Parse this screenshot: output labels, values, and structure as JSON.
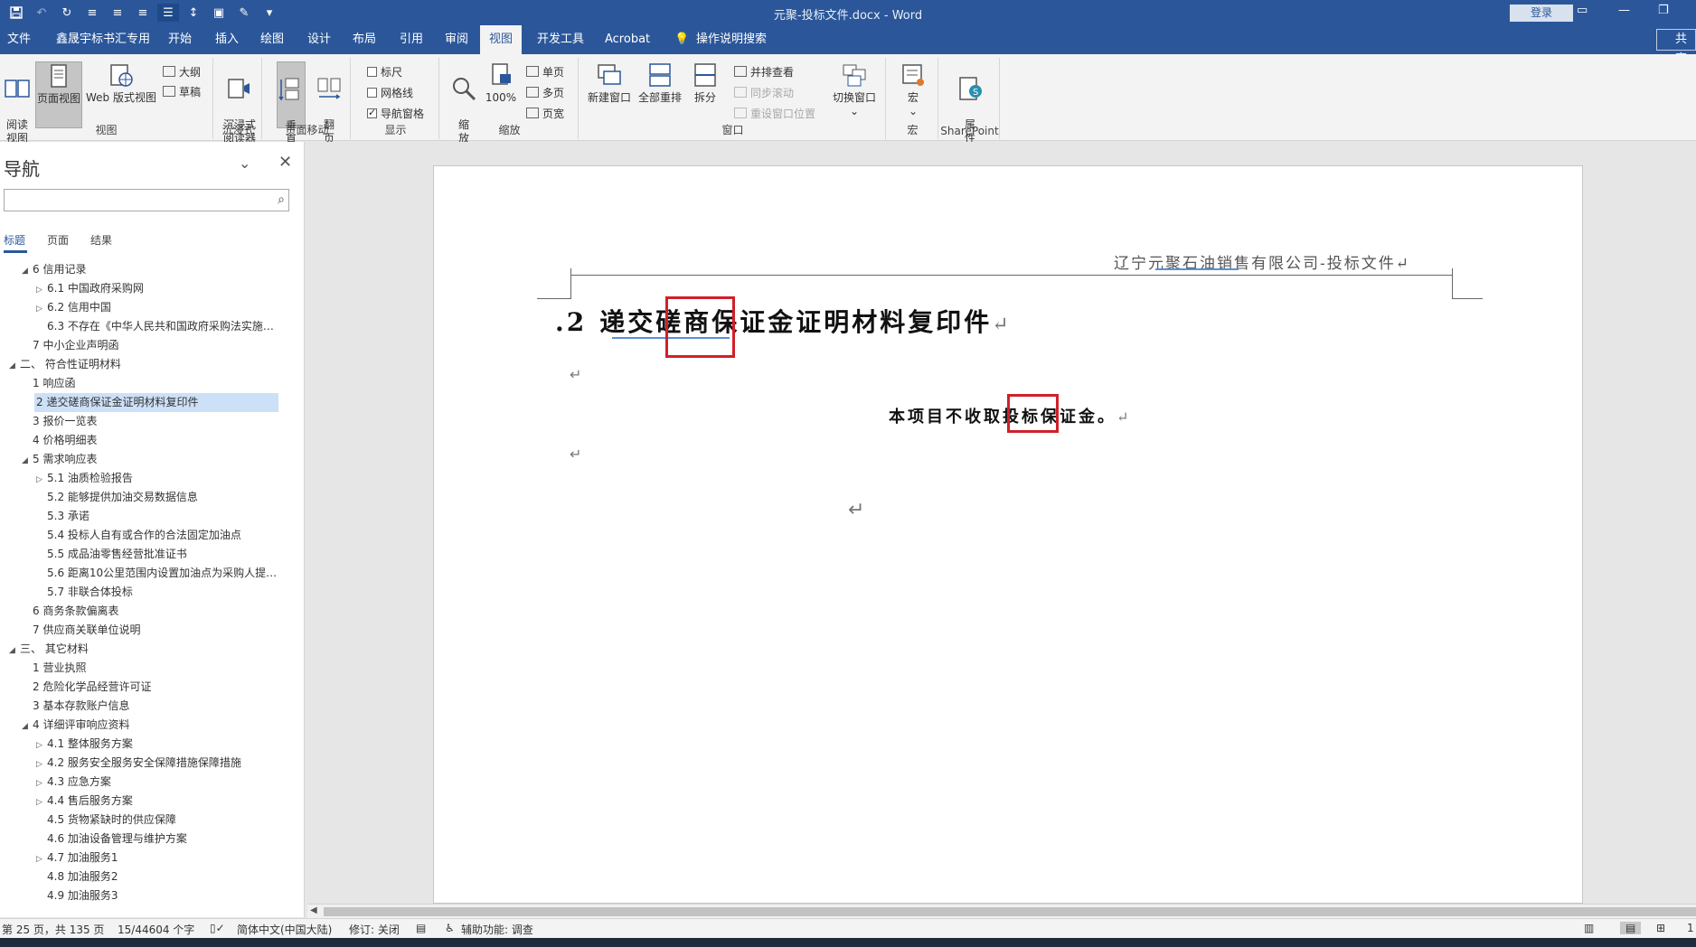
{
  "titlebar": {
    "doc_title": "元聚-投标文件.docx - Word",
    "login": "登录",
    "qat": [
      "save-icon",
      "undo-icon",
      "redo-icon",
      "align-left-icon",
      "align-center-icon",
      "align-right-icon",
      "justify-icon",
      "line-spacing-icon",
      "form-icon",
      "format-painter-icon",
      "customize-icon"
    ]
  },
  "tabs": {
    "file": "文件",
    "custom": "鑫晟宇标书汇专用",
    "home": "开始",
    "insert": "插入",
    "draw": "绘图",
    "design": "设计",
    "layout": "布局",
    "references": "引用",
    "review": "审阅",
    "view": "视图",
    "developer": "开发工具",
    "acrobat": "Acrobat",
    "tellme": "操作说明搜索",
    "share": "共享"
  },
  "ribbon": {
    "views": {
      "read_mode": "阅读\n视图",
      "print_layout": "页面视图",
      "web_layout": "Web 版式视图",
      "outline": "大纲",
      "draft": "草稿",
      "label": "视图"
    },
    "immersive": {
      "reader": "沉浸式\n阅读器",
      "label": "沉浸式"
    },
    "page_movement": {
      "vertical": "垂\n直",
      "side_to_side": "翻\n页",
      "label": "页面移动"
    },
    "show": {
      "ruler": "标尺",
      "gridlines": "网格线",
      "nav_pane": "导航窗格",
      "label": "显示",
      "ruler_checked": false,
      "gridlines_checked": false,
      "nav_pane_checked": true
    },
    "zoom": {
      "zoom": "缩\n放",
      "hundred": "100%",
      "one_page": "单页",
      "multi_page": "多页",
      "page_width": "页宽",
      "label": "缩放"
    },
    "window": {
      "new_window": "新建窗口",
      "arrange_all": "全部重排",
      "split": "拆分",
      "side_by_side": "并排查看",
      "sync_scroll": "同步滚动",
      "reset_position": "重设窗口位置",
      "switch_windows": "切换窗口",
      "label": "窗口"
    },
    "macros": {
      "macros": "宏",
      "label": "宏"
    },
    "sharepoint": {
      "properties": "属\n性",
      "label": "SharePoint"
    }
  },
  "nav": {
    "title": "导航",
    "search_placeholder": "",
    "tabs": [
      "标题",
      "页面",
      "结果"
    ],
    "items": [
      {
        "text": "6 信用记录",
        "level": 2,
        "tri": "◢"
      },
      {
        "text": "6.1 中国政府采购网",
        "level": 3,
        "tri": "▷"
      },
      {
        "text": "6.2 信用中国",
        "level": 3,
        "tri": "▷"
      },
      {
        "text": "6.3 不存在《中华人民共和国政府采购法实施…",
        "level": 3,
        "tri": ""
      },
      {
        "text": "7 中小企业声明函",
        "level": 2,
        "tri": ""
      },
      {
        "text": "二、 符合性证明材料",
        "level": 1,
        "tri": "◢"
      },
      {
        "text": "1 响应函",
        "level": 2,
        "tri": ""
      },
      {
        "text": "2 递交磋商保证金证明材料复印件",
        "level": 2,
        "tri": "",
        "selected": true
      },
      {
        "text": "3 报价一览表",
        "level": 2,
        "tri": ""
      },
      {
        "text": "4 价格明细表",
        "level": 2,
        "tri": ""
      },
      {
        "text": "5 需求响应表",
        "level": 2,
        "tri": "◢"
      },
      {
        "text": "5.1 油质检验报告",
        "level": 3,
        "tri": "▷"
      },
      {
        "text": "5.2 能够提供加油交易数据信息",
        "level": 3,
        "tri": ""
      },
      {
        "text": "5.3 承诺",
        "level": 3,
        "tri": ""
      },
      {
        "text": "5.4 投标人自有或合作的合法固定加油点",
        "level": 3,
        "tri": ""
      },
      {
        "text": "5.5 成品油零售经营批准证书",
        "level": 3,
        "tri": ""
      },
      {
        "text": "5.6 距离10公里范围内设置加油点为采购人提…",
        "level": 3,
        "tri": ""
      },
      {
        "text": "5.7 非联合体投标",
        "level": 3,
        "tri": ""
      },
      {
        "text": "6 商务条款偏离表",
        "level": 2,
        "tri": ""
      },
      {
        "text": "7 供应商关联单位说明",
        "level": 2,
        "tri": ""
      },
      {
        "text": "三、 其它材料",
        "level": 1,
        "tri": "◢"
      },
      {
        "text": "1 营业执照",
        "level": 2,
        "tri": ""
      },
      {
        "text": "2 危险化学品经营许可证",
        "level": 2,
        "tri": ""
      },
      {
        "text": "3 基本存款账户信息",
        "level": 2,
        "tri": ""
      },
      {
        "text": "4 详细评审响应资料",
        "level": 2,
        "tri": "◢"
      },
      {
        "text": "4.1 整体服务方案",
        "level": 3,
        "tri": "▷"
      },
      {
        "text": "4.2 服务安全服务安全保障措施保障措施",
        "level": 3,
        "tri": "▷"
      },
      {
        "text": "4.3 应急方案",
        "level": 3,
        "tri": "▷"
      },
      {
        "text": "4.4 售后服务方案",
        "level": 3,
        "tri": "▷"
      },
      {
        "text": "4.5 货物紧缺时的供应保障",
        "level": 3,
        "tri": ""
      },
      {
        "text": "4.6 加油设备管理与维护方案",
        "level": 3,
        "tri": ""
      },
      {
        "text": "4.7 加油服务1",
        "level": 3,
        "tri": "▷"
      },
      {
        "text": "4.8 加油服务2",
        "level": 3,
        "tri": ""
      },
      {
        "text": "4.9 加油服务3",
        "level": 3,
        "tri": ""
      }
    ]
  },
  "document": {
    "header": "辽宁元聚石油销售有限公司-投标文件↵",
    "heading_num": ".2",
    "heading_text": "递交磋商保证金证明材料复印件",
    "heading_ret": "↵",
    "body_text": "本项目不收取投标保证金。",
    "body_ret": "↵",
    "para_mark": "↵"
  },
  "status": {
    "page": "第 25 页，共 135 页",
    "words": "15/44604 个字",
    "language": "简体中文(中国大陆)",
    "track_changes": "修订: 关闭",
    "accessibility": "辅助功能: 调查",
    "zoom_partial": "1"
  }
}
